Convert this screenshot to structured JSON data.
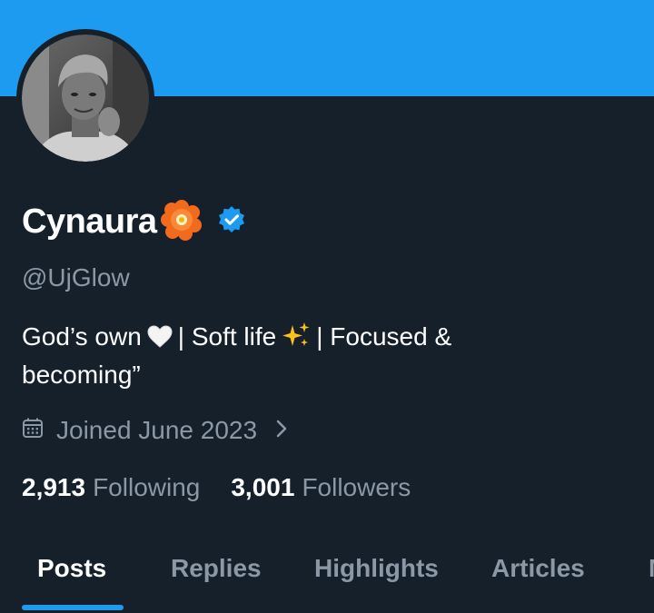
{
  "colors": {
    "banner": "#1d9bf0",
    "background": "#15202b",
    "primary_text": "#ffffff",
    "secondary_text": "#8b98a5",
    "verified_badge": "#1d9bf0",
    "tab_indicator": "#1d9bf0"
  },
  "profile": {
    "display_name": "Cynaura",
    "name_emoji": "flower-icon",
    "verified": true,
    "handle": "@UjGlow",
    "bio": {
      "part1": "God’s own",
      "emoji1": "white-heart-icon",
      "part2": "| Soft life",
      "emoji2": "sparkles-icon",
      "part3": "| Focused & becoming”"
    },
    "joined": "Joined June 2023",
    "joined_icon": "calendar-icon",
    "following_count": "2,913",
    "following_label": "Following",
    "followers_count": "3,001",
    "followers_label": "Followers"
  },
  "tabs": [
    {
      "label": "Posts",
      "active": true
    },
    {
      "label": "Replies",
      "active": false
    },
    {
      "label": "Highlights",
      "active": false
    },
    {
      "label": "Articles",
      "active": false
    },
    {
      "label": "M",
      "active": false
    }
  ]
}
